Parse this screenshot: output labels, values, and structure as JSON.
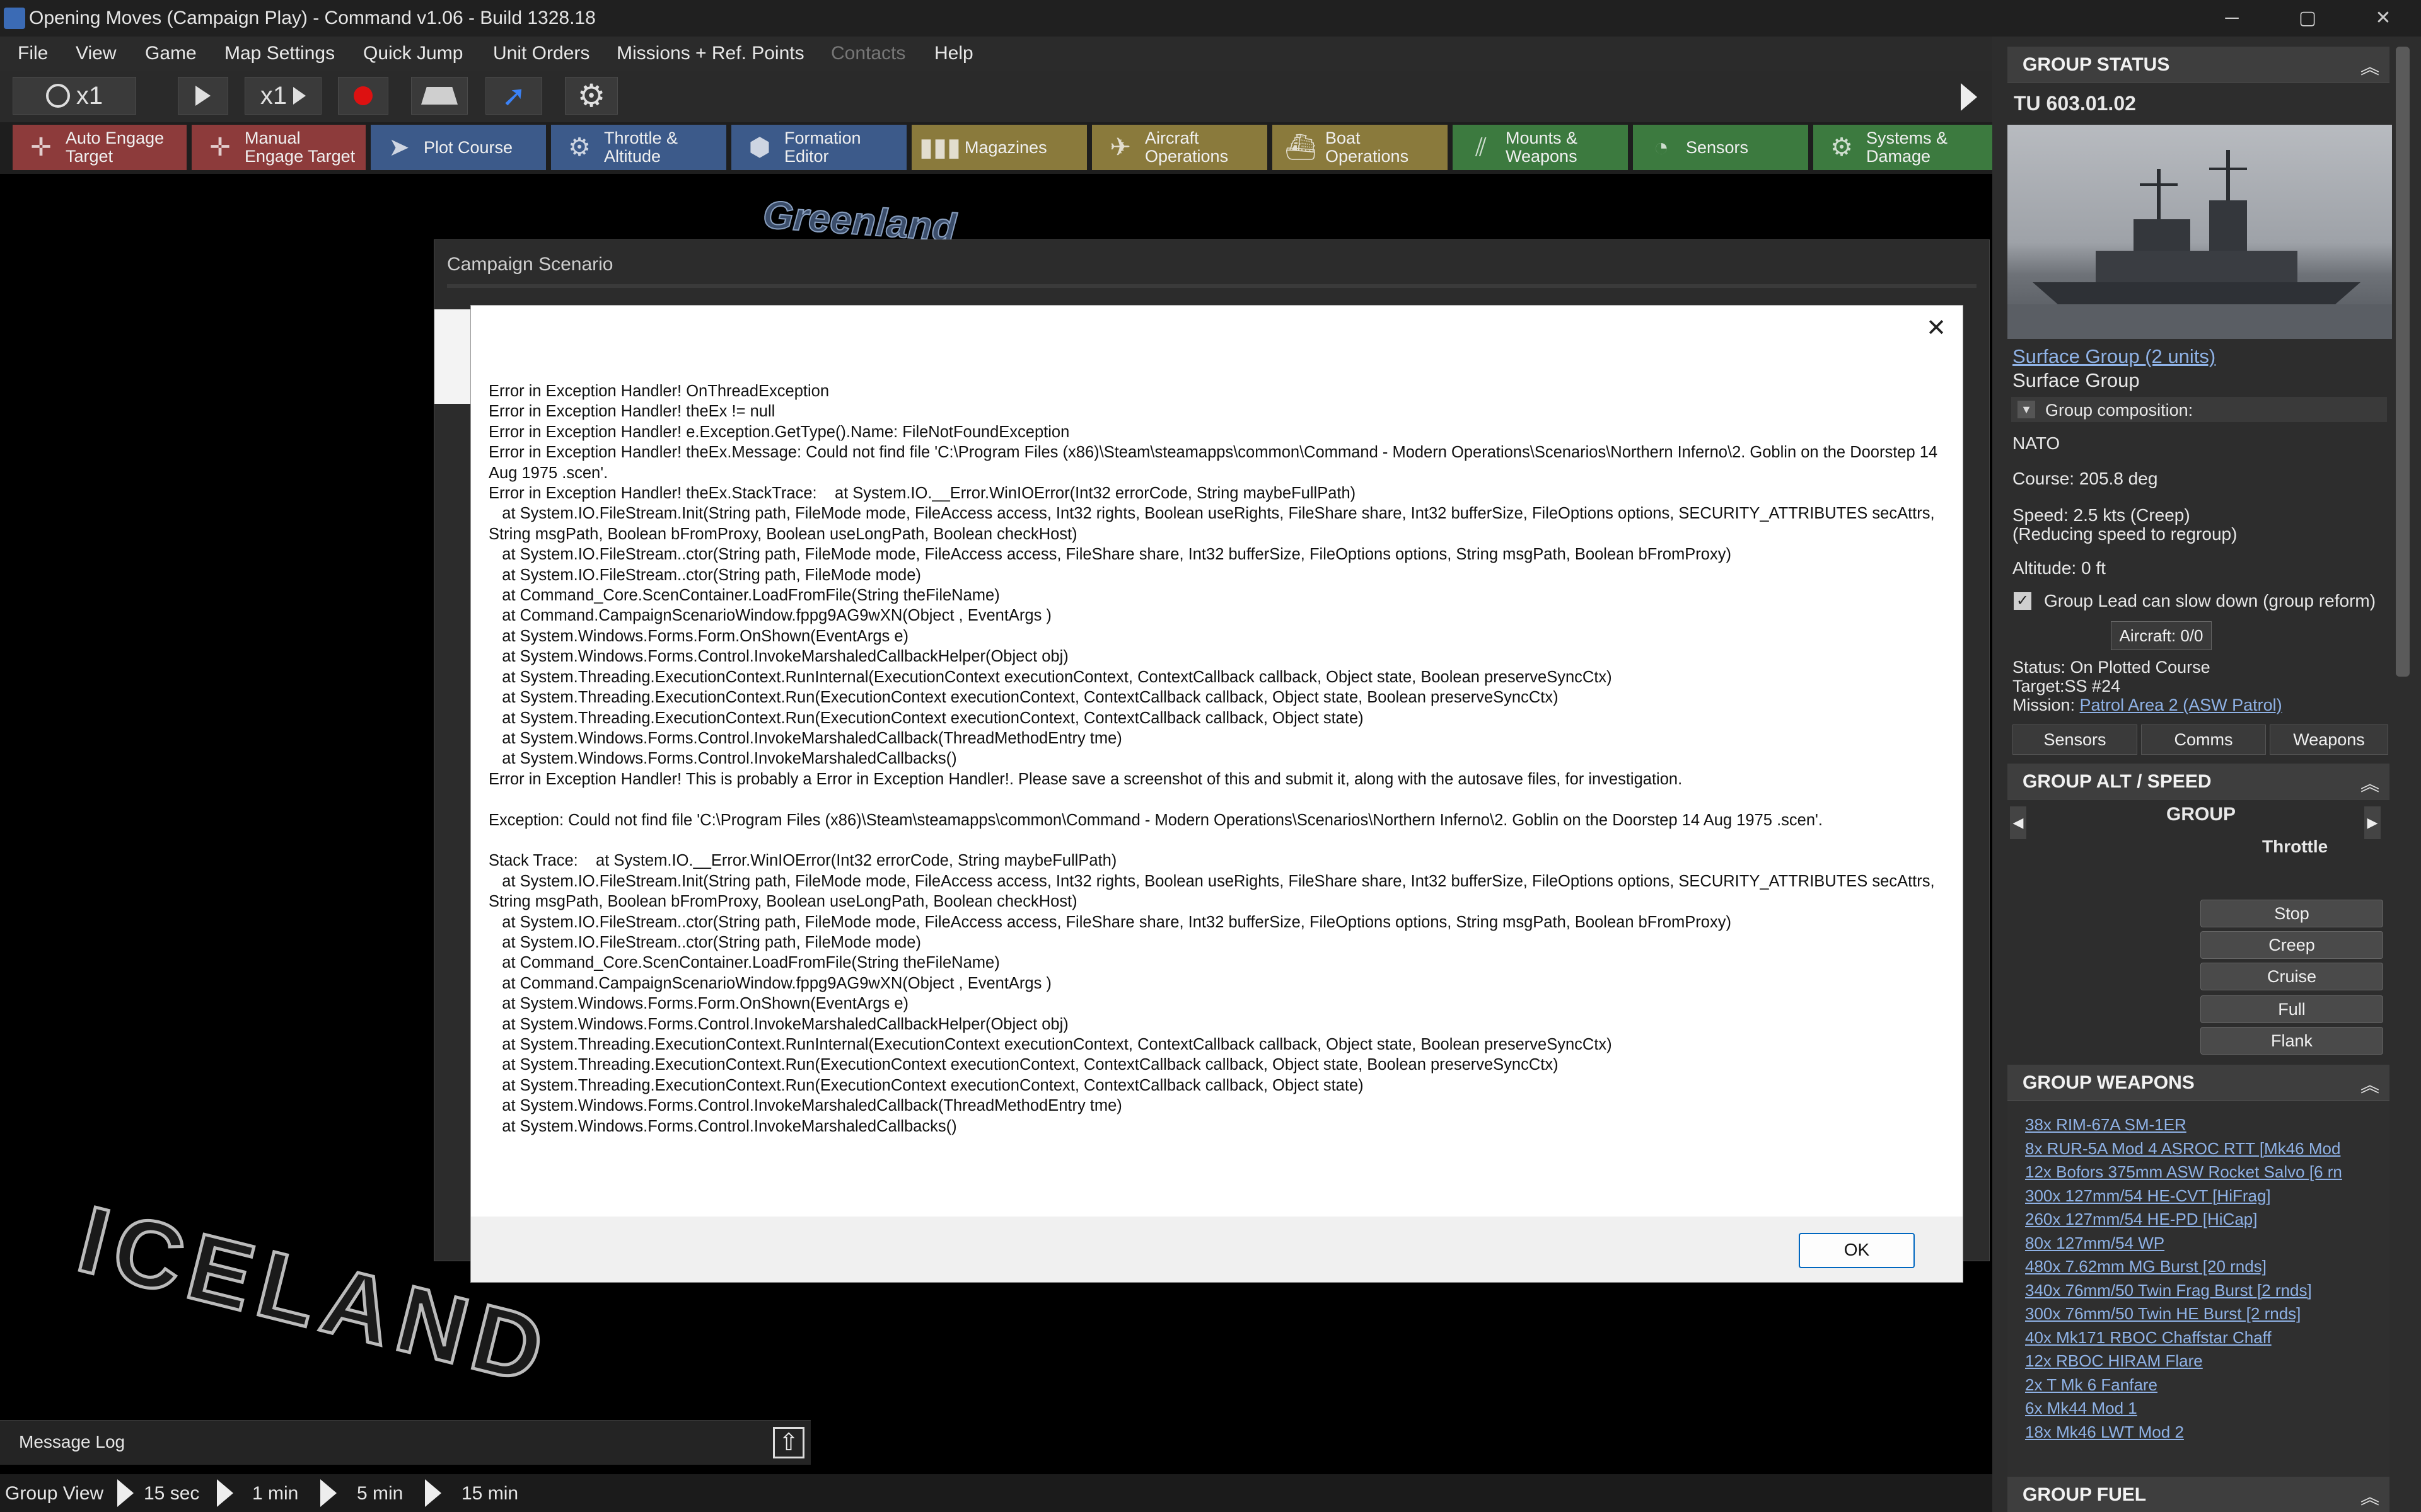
{
  "window": {
    "title": "Opening Moves (Campaign Play) - Command v1.06 - Build 1328.18",
    "minimize": "─",
    "maximize": "▢",
    "close": "✕"
  },
  "menu": [
    "File",
    "View",
    "Game",
    "Map Settings",
    "Quick Jump",
    "Unit Orders",
    "Missions + Ref. Points",
    "Contacts",
    "Help"
  ],
  "timebar": {
    "compression_label": "x1",
    "step_label": "x1"
  },
  "commands": {
    "auto_engage": [
      "Auto Engage",
      "Target"
    ],
    "manual_engage": [
      "Manual",
      "Engage Target"
    ],
    "plot_course": "Plot Course",
    "throttle": [
      "Throttle &",
      "Altitude"
    ],
    "formation": [
      "Formation",
      "Editor"
    ],
    "magazines": "Magazines",
    "aircraft_ops": [
      "Aircraft",
      "Operations"
    ],
    "boat_ops": [
      "Boat",
      "Operations"
    ],
    "mounts": [
      "Mounts &",
      "Weapons"
    ],
    "sensors": "Sensors",
    "systems": [
      "Systems &",
      "Damage"
    ]
  },
  "map": {
    "region_label": "ICELAND",
    "partial_label": "Greenland"
  },
  "campaign_window": {
    "title": "Campaign Scenario"
  },
  "error_dialog": {
    "text": "Error in Exception Handler! OnThreadException\nError in Exception Handler! theEx != null\nError in Exception Handler! e.Exception.GetType().Name: FileNotFoundException\nError in Exception Handler! theEx.Message: Could not find file 'C:\\Program Files (x86)\\Steam\\steamapps\\common\\Command - Modern Operations\\Scenarios\\Northern Inferno\\2. Goblin on the Doorstep 14 Aug 1975 .scen'.\nError in Exception Handler! theEx.StackTrace:    at System.IO.__Error.WinIOError(Int32 errorCode, String maybeFullPath)\n   at System.IO.FileStream.Init(String path, FileMode mode, FileAccess access, Int32 rights, Boolean useRights, FileShare share, Int32 bufferSize, FileOptions options, SECURITY_ATTRIBUTES secAttrs, String msgPath, Boolean bFromProxy, Boolean useLongPath, Boolean checkHost)\n   at System.IO.FileStream..ctor(String path, FileMode mode, FileAccess access, FileShare share, Int32 bufferSize, FileOptions options, String msgPath, Boolean bFromProxy)\n   at System.IO.FileStream..ctor(String path, FileMode mode)\n   at Command_Core.ScenContainer.LoadFromFile(String theFileName)\n   at Command.CampaignScenarioWindow.fppg9AG9wXN(Object , EventArgs )\n   at System.Windows.Forms.Form.OnShown(EventArgs e)\n   at System.Windows.Forms.Control.InvokeMarshaledCallbackHelper(Object obj)\n   at System.Threading.ExecutionContext.RunInternal(ExecutionContext executionContext, ContextCallback callback, Object state, Boolean preserveSyncCtx)\n   at System.Threading.ExecutionContext.Run(ExecutionContext executionContext, ContextCallback callback, Object state, Boolean preserveSyncCtx)\n   at System.Threading.ExecutionContext.Run(ExecutionContext executionContext, ContextCallback callback, Object state)\n   at System.Windows.Forms.Control.InvokeMarshaledCallback(ThreadMethodEntry tme)\n   at System.Windows.Forms.Control.InvokeMarshaledCallbacks()\nError in Exception Handler! This is probably a Error in Exception Handler!. Please save a screenshot of this and submit it, along with the autosave files, for investigation.\n\nException: Could not find file 'C:\\Program Files (x86)\\Steam\\steamapps\\common\\Command - Modern Operations\\Scenarios\\Northern Inferno\\2. Goblin on the Doorstep 14 Aug 1975 .scen'.\n\nStack Trace:    at System.IO.__Error.WinIOError(Int32 errorCode, String maybeFullPath)\n   at System.IO.FileStream.Init(String path, FileMode mode, FileAccess access, Int32 rights, Boolean useRights, FileShare share, Int32 bufferSize, FileOptions options, SECURITY_ATTRIBUTES secAttrs, String msgPath, Boolean bFromProxy, Boolean useLongPath, Boolean checkHost)\n   at System.IO.FileStream..ctor(String path, FileMode mode, FileAccess access, FileShare share, Int32 bufferSize, FileOptions options, String msgPath, Boolean bFromProxy)\n   at System.IO.FileStream..ctor(String path, FileMode mode)\n   at Command_Core.ScenContainer.LoadFromFile(String theFileName)\n   at Command.CampaignScenarioWindow.fppg9AG9wXN(Object , EventArgs )\n   at System.Windows.Forms.Form.OnShown(EventArgs e)\n   at System.Windows.Forms.Control.InvokeMarshaledCallbackHelper(Object obj)\n   at System.Threading.ExecutionContext.RunInternal(ExecutionContext executionContext, ContextCallback callback, Object state, Boolean preserveSyncCtx)\n   at System.Threading.ExecutionContext.Run(ExecutionContext executionContext, ContextCallback callback, Object state, Boolean preserveSyncCtx)\n   at System.Threading.ExecutionContext.Run(ExecutionContext executionContext, ContextCallback callback, Object state)\n   at System.Windows.Forms.Control.InvokeMarshaledCallback(ThreadMethodEntry tme)\n   at System.Windows.Forms.Control.InvokeMarshaledCallbacks()",
    "ok_label": "OK",
    "close_glyph": "✕"
  },
  "message_log": {
    "label": "Message Log",
    "expand_glyph": "⇧"
  },
  "bottom_bar": {
    "group_view": "Group View",
    "steps": [
      "15 sec",
      "1 min",
      "5 min",
      "15 min"
    ]
  },
  "right_panel": {
    "status_header": "GROUP STATUS",
    "unit_id": "TU 603.01.02",
    "group_link": "Surface Group (2 units)",
    "group_type": "Surface Group",
    "composition_label": "Group composition:",
    "side": "NATO",
    "course": "Course: 205.8 deg",
    "speed_line1": "Speed: 2.5 kts (Creep)",
    "speed_line2": "(Reducing speed to regroup)",
    "altitude": "Altitude: 0 ft",
    "group_lead_checkbox": "Group Lead can slow down (group reform)",
    "aircraft": "Aircraft: 0/0",
    "status": "Status: On Plotted Course",
    "target": "Target:SS #24",
    "mission_label": "Mission: ",
    "mission_link": "Patrol Area 2 (ASW Patrol)",
    "tabs": [
      "Sensors",
      "Comms",
      "Weapons"
    ],
    "altspeed_header": "GROUP ALT / SPEED",
    "group_label": "GROUP",
    "throttle_label": "Throttle",
    "speed_buttons": [
      "Stop",
      "Creep",
      "Cruise",
      "Full",
      "Flank"
    ],
    "weapons_header": "GROUP WEAPONS",
    "weapons": [
      "38x RIM-67A SM-1ER",
      "8x RUR-5A Mod 4 ASROC RTT [Mk46 Mod",
      "12x Bofors 375mm ASW Rocket Salvo [6 rn",
      "300x 127mm/54 HE-CVT [HiFrag]",
      "260x 127mm/54 HE-PD [HiCap]",
      "80x 127mm/54 WP",
      "480x 7.62mm MG Burst [20 rnds]",
      "340x 76mm/50 Twin Frag Burst [2 rnds]",
      "300x 76mm/50 Twin HE Burst [2 rnds]",
      "40x Mk171 RBOC Chaffstar Chaff",
      "12x RBOC HIRAM Flare",
      "2x T Mk 6 Fanfare",
      "6x Mk44 Mod 1",
      "18x Mk46 LWT Mod 2"
    ],
    "fuel_header": "GROUP FUEL"
  }
}
